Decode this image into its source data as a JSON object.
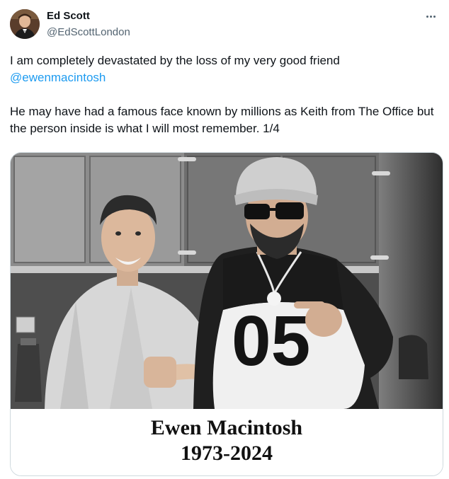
{
  "author": {
    "name": "Ed Scott",
    "handle": "@EdScottLondon"
  },
  "tweet": {
    "line1": "I am completely devastated by the loss of my very good friend",
    "mention": "@ewenmacintosh",
    "line2": "He may have had a famous face known by millions as Keith from The Office but the person inside is what I will most remember. 1/4"
  },
  "media": {
    "jersey_number": "05",
    "caption_name": "Ewen Macintosh",
    "caption_years": "1973-2024"
  },
  "icons": {
    "more": "more-options-icon"
  },
  "colors": {
    "link": "#1d9bf0",
    "secondary_text": "#536471",
    "border": "#cfd9de"
  }
}
